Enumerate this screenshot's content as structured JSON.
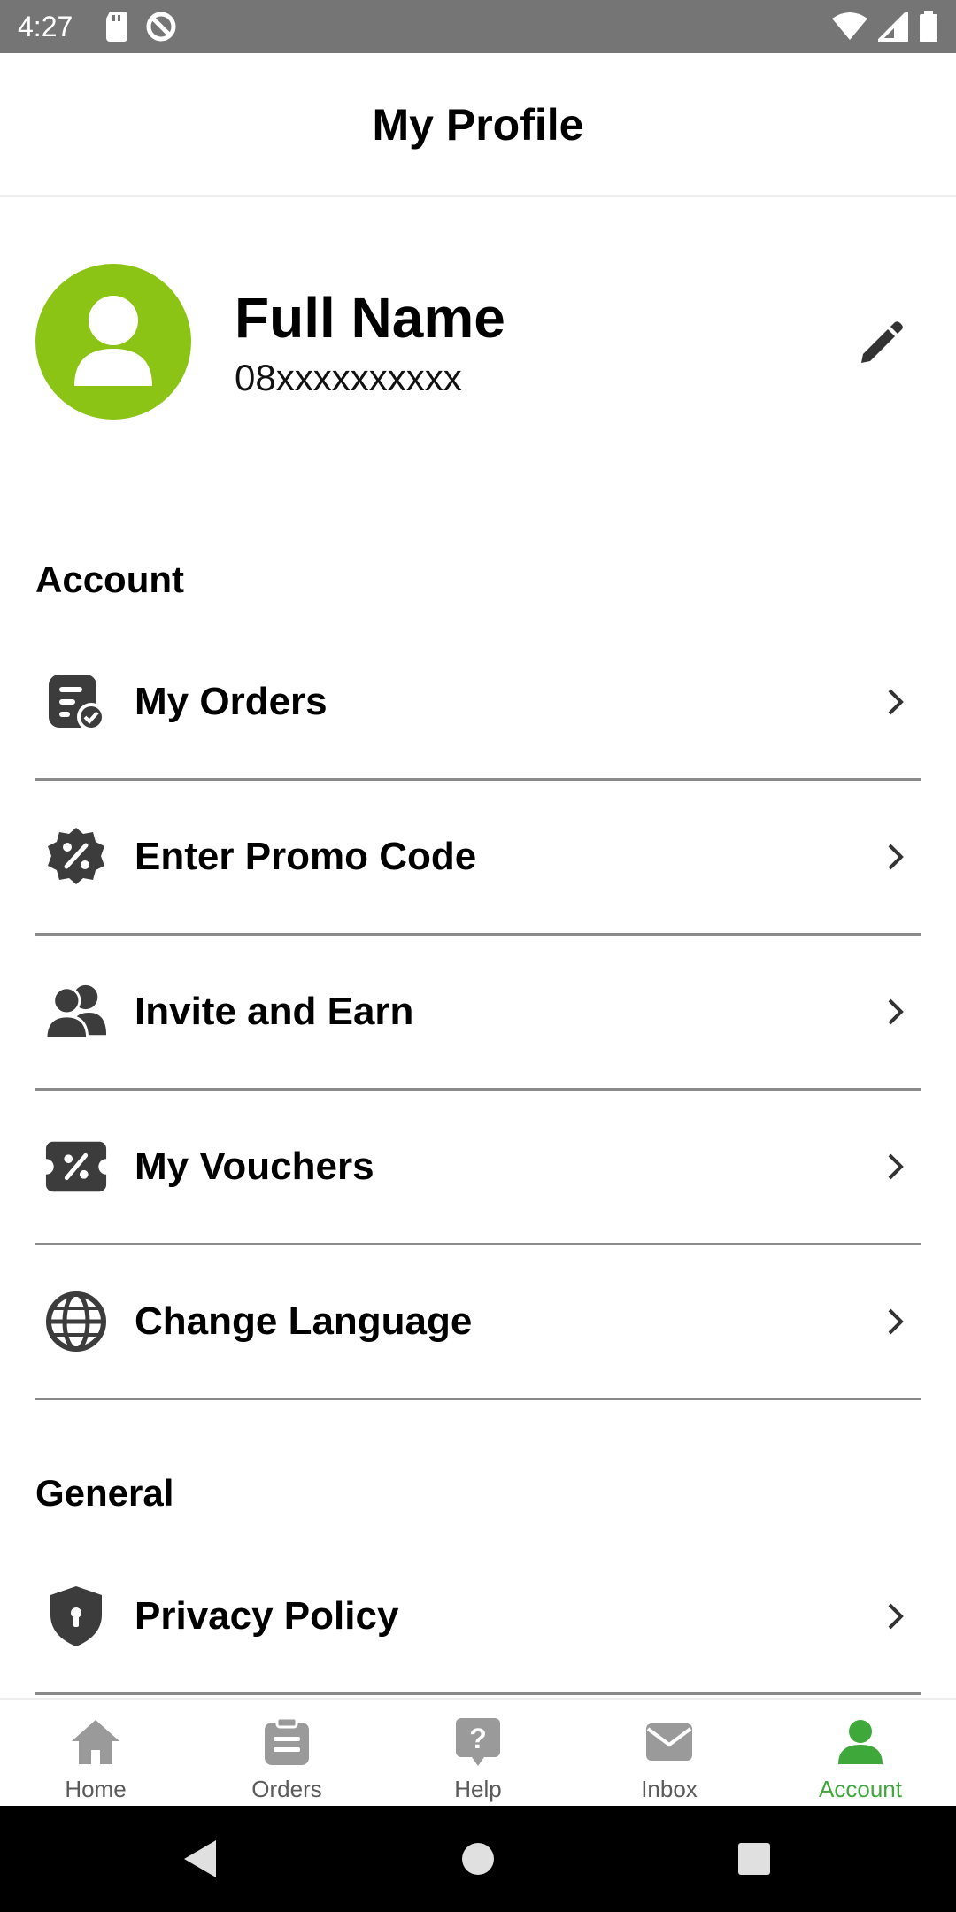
{
  "status_bar": {
    "time": "4:27"
  },
  "app_bar": {
    "title": "My Profile"
  },
  "profile": {
    "name": "Full Name",
    "phone": "08xxxxxxxxxx"
  },
  "sections": {
    "account_title": "Account",
    "general_title": "General"
  },
  "menu": {
    "account_items": [
      {
        "label": "My Orders",
        "icon": "orders-check-icon"
      },
      {
        "label": "Enter Promo Code",
        "icon": "promo-badge-icon"
      },
      {
        "label": "Invite and Earn",
        "icon": "users-icon"
      },
      {
        "label": "My Vouchers",
        "icon": "voucher-icon"
      },
      {
        "label": "Change Language",
        "icon": "globe-icon"
      }
    ],
    "general_items": [
      {
        "label": "Privacy Policy",
        "icon": "shield-lock-icon"
      }
    ]
  },
  "bottom_nav": [
    {
      "label": "Home",
      "icon": "home-icon",
      "active": false
    },
    {
      "label": "Orders",
      "icon": "clipboard-icon",
      "active": false
    },
    {
      "label": "Help",
      "icon": "help-icon",
      "active": false
    },
    {
      "label": "Inbox",
      "icon": "mail-icon",
      "active": false
    },
    {
      "label": "Account",
      "icon": "person-icon",
      "active": true
    }
  ],
  "colors": {
    "accent": "#3ea83a",
    "avatar_bg": "#8cc415",
    "icon_dark": "#3c3c3c",
    "nav_inactive": "#9a9a9a",
    "divider": "#8a8a8a",
    "status_bar": "#757575"
  }
}
